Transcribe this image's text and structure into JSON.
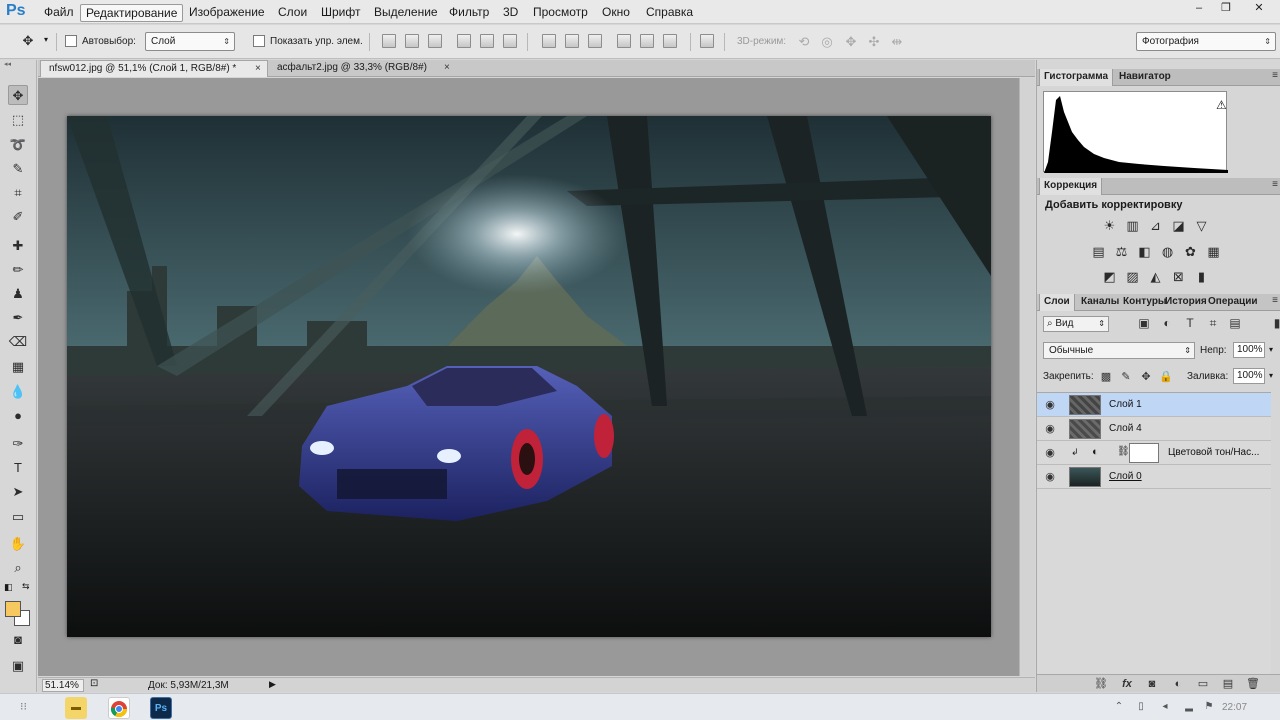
{
  "app": {
    "logo": "Ps",
    "menu": [
      "Файл",
      "Редактирование",
      "Изображение",
      "Слои",
      "Шрифт",
      "Выделение",
      "Фильтр",
      "3D",
      "Просмотр",
      "Окно",
      "Справка"
    ],
    "active_menu": "Редактирование",
    "window_controls": {
      "minimize": "‒",
      "maximize": "❐",
      "close": "✕"
    }
  },
  "options": {
    "auto_select_label": "Автовыбор:",
    "auto_select_target": "Слой",
    "show_controls_label": "Показать упр. элем.",
    "mode_3d_label": "3D-режим:",
    "workspace": "Фотография"
  },
  "tabs": [
    {
      "title": "nfsw012.jpg @ 51,1% (Слой 1, RGB/8#) *",
      "close": "×",
      "active": true
    },
    {
      "title": "асфальт2.jpg @ 33,3% (RGB/8#)",
      "close": "×",
      "active": false
    }
  ],
  "status": {
    "zoom": "51.14%",
    "doc_size": "Док: 5,93M/21,3M",
    "arrow": "▶"
  },
  "panels": {
    "top_tabs": [
      "Гистограмма",
      "Навигатор"
    ],
    "histogram_warning": "⚠",
    "correction_tab": "Коррекция",
    "correction_title": "Добавить корректировку",
    "layers_tabs": [
      "Слои",
      "Каналы",
      "Контуры",
      "История",
      "Операции"
    ],
    "panel_menu": "≡"
  },
  "layers_panel": {
    "filter_label": "Вид",
    "blend_mode": "Обычные",
    "opacity_label": "Непр:",
    "opacity": "100%",
    "lock_label": "Закрепить:",
    "fill_label": "Заливка:",
    "fill": "100%",
    "layers": [
      {
        "name": "Слой 1",
        "selected": true,
        "thumb": "dark"
      },
      {
        "name": "Слой 4",
        "selected": false,
        "thumb": "dark"
      },
      {
        "name": "Цветовой тон/Нас...",
        "selected": false,
        "thumb": "adjust"
      },
      {
        "name": "Слой 0",
        "selected": false,
        "thumb": "photo"
      }
    ],
    "eye_icon": "👁"
  },
  "tools": [
    "▸✛",
    "⬚",
    "ʃ",
    "✎",
    "⌗",
    "✐",
    "⊕",
    "✚",
    "♟",
    "✒",
    "⌫",
    "▦",
    "◐",
    "◔",
    "✑",
    "T",
    "➤",
    "▭",
    "✋",
    "🔍"
  ],
  "taskbar": {
    "clock": "22:07",
    "apps": [
      "folder",
      "chrome",
      "Ps"
    ]
  }
}
